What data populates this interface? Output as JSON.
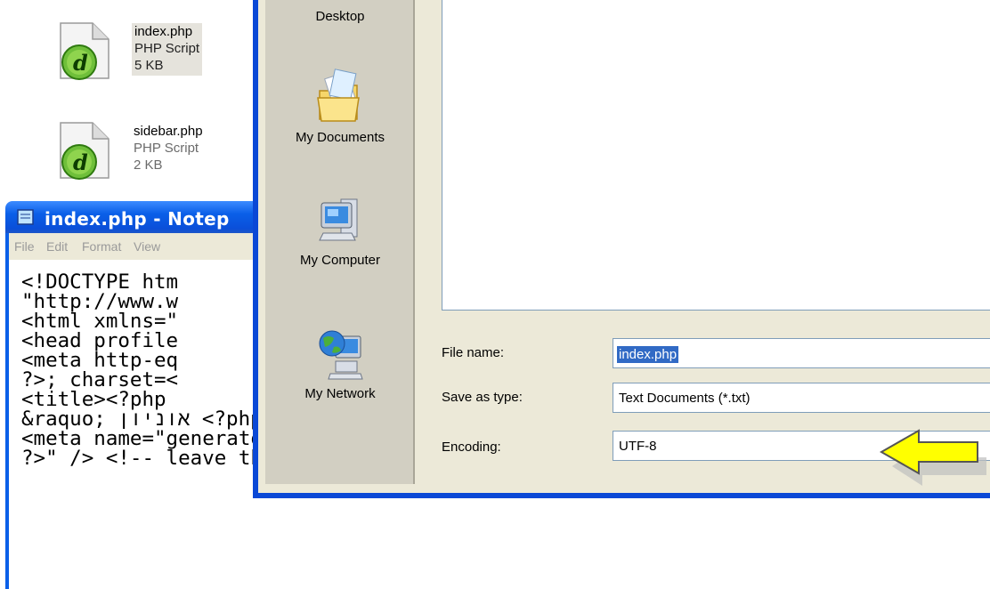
{
  "desktop_files": [
    {
      "name": "index.php",
      "type": "PHP Script",
      "size": "5 KB",
      "selected": true
    },
    {
      "name": "sidebar.php",
      "type": "PHP Script",
      "size": "2 KB",
      "selected": false
    }
  ],
  "notepad": {
    "title": "index.php - Notep",
    "menu": [
      "File",
      "Edit",
      "Format",
      "View"
    ],
    "lines": [
      "<!DOCTYPE htm",
      "\"http://www.w",
      "<html xmlns=\"",
      "<head profile",
      "<meta http-eq",
      "?>; charset=<",
      "<title><?php",
      "&raquo; אוניון <?php } ?> <?php wp_title(); ?></titl",
      "<meta name=\"generator\" content=\"WordPress <?php b",
      "?>\" /> <!-- leave this for stats -->"
    ]
  },
  "save_dialog": {
    "places": [
      "Desktop",
      "My Documents",
      "My Computer",
      "My Network"
    ],
    "file_name_label": "File name:",
    "file_name_value": "index.php",
    "save_as_type_label": "Save as type:",
    "save_as_type_value": "Text Documents (*.txt)",
    "encoding_label": "Encoding:",
    "encoding_value": "UTF-8"
  },
  "colors": {
    "xp_blue": "#0a5fe8",
    "dialog_bg": "#ece9d8",
    "arrow": "#ffff00"
  },
  "icons": [
    "dreamweaver-php-file-icon",
    "notepad-icon",
    "my-documents-folder-icon",
    "my-computer-icon",
    "my-network-icon",
    "yellow-arrow-icon"
  ]
}
